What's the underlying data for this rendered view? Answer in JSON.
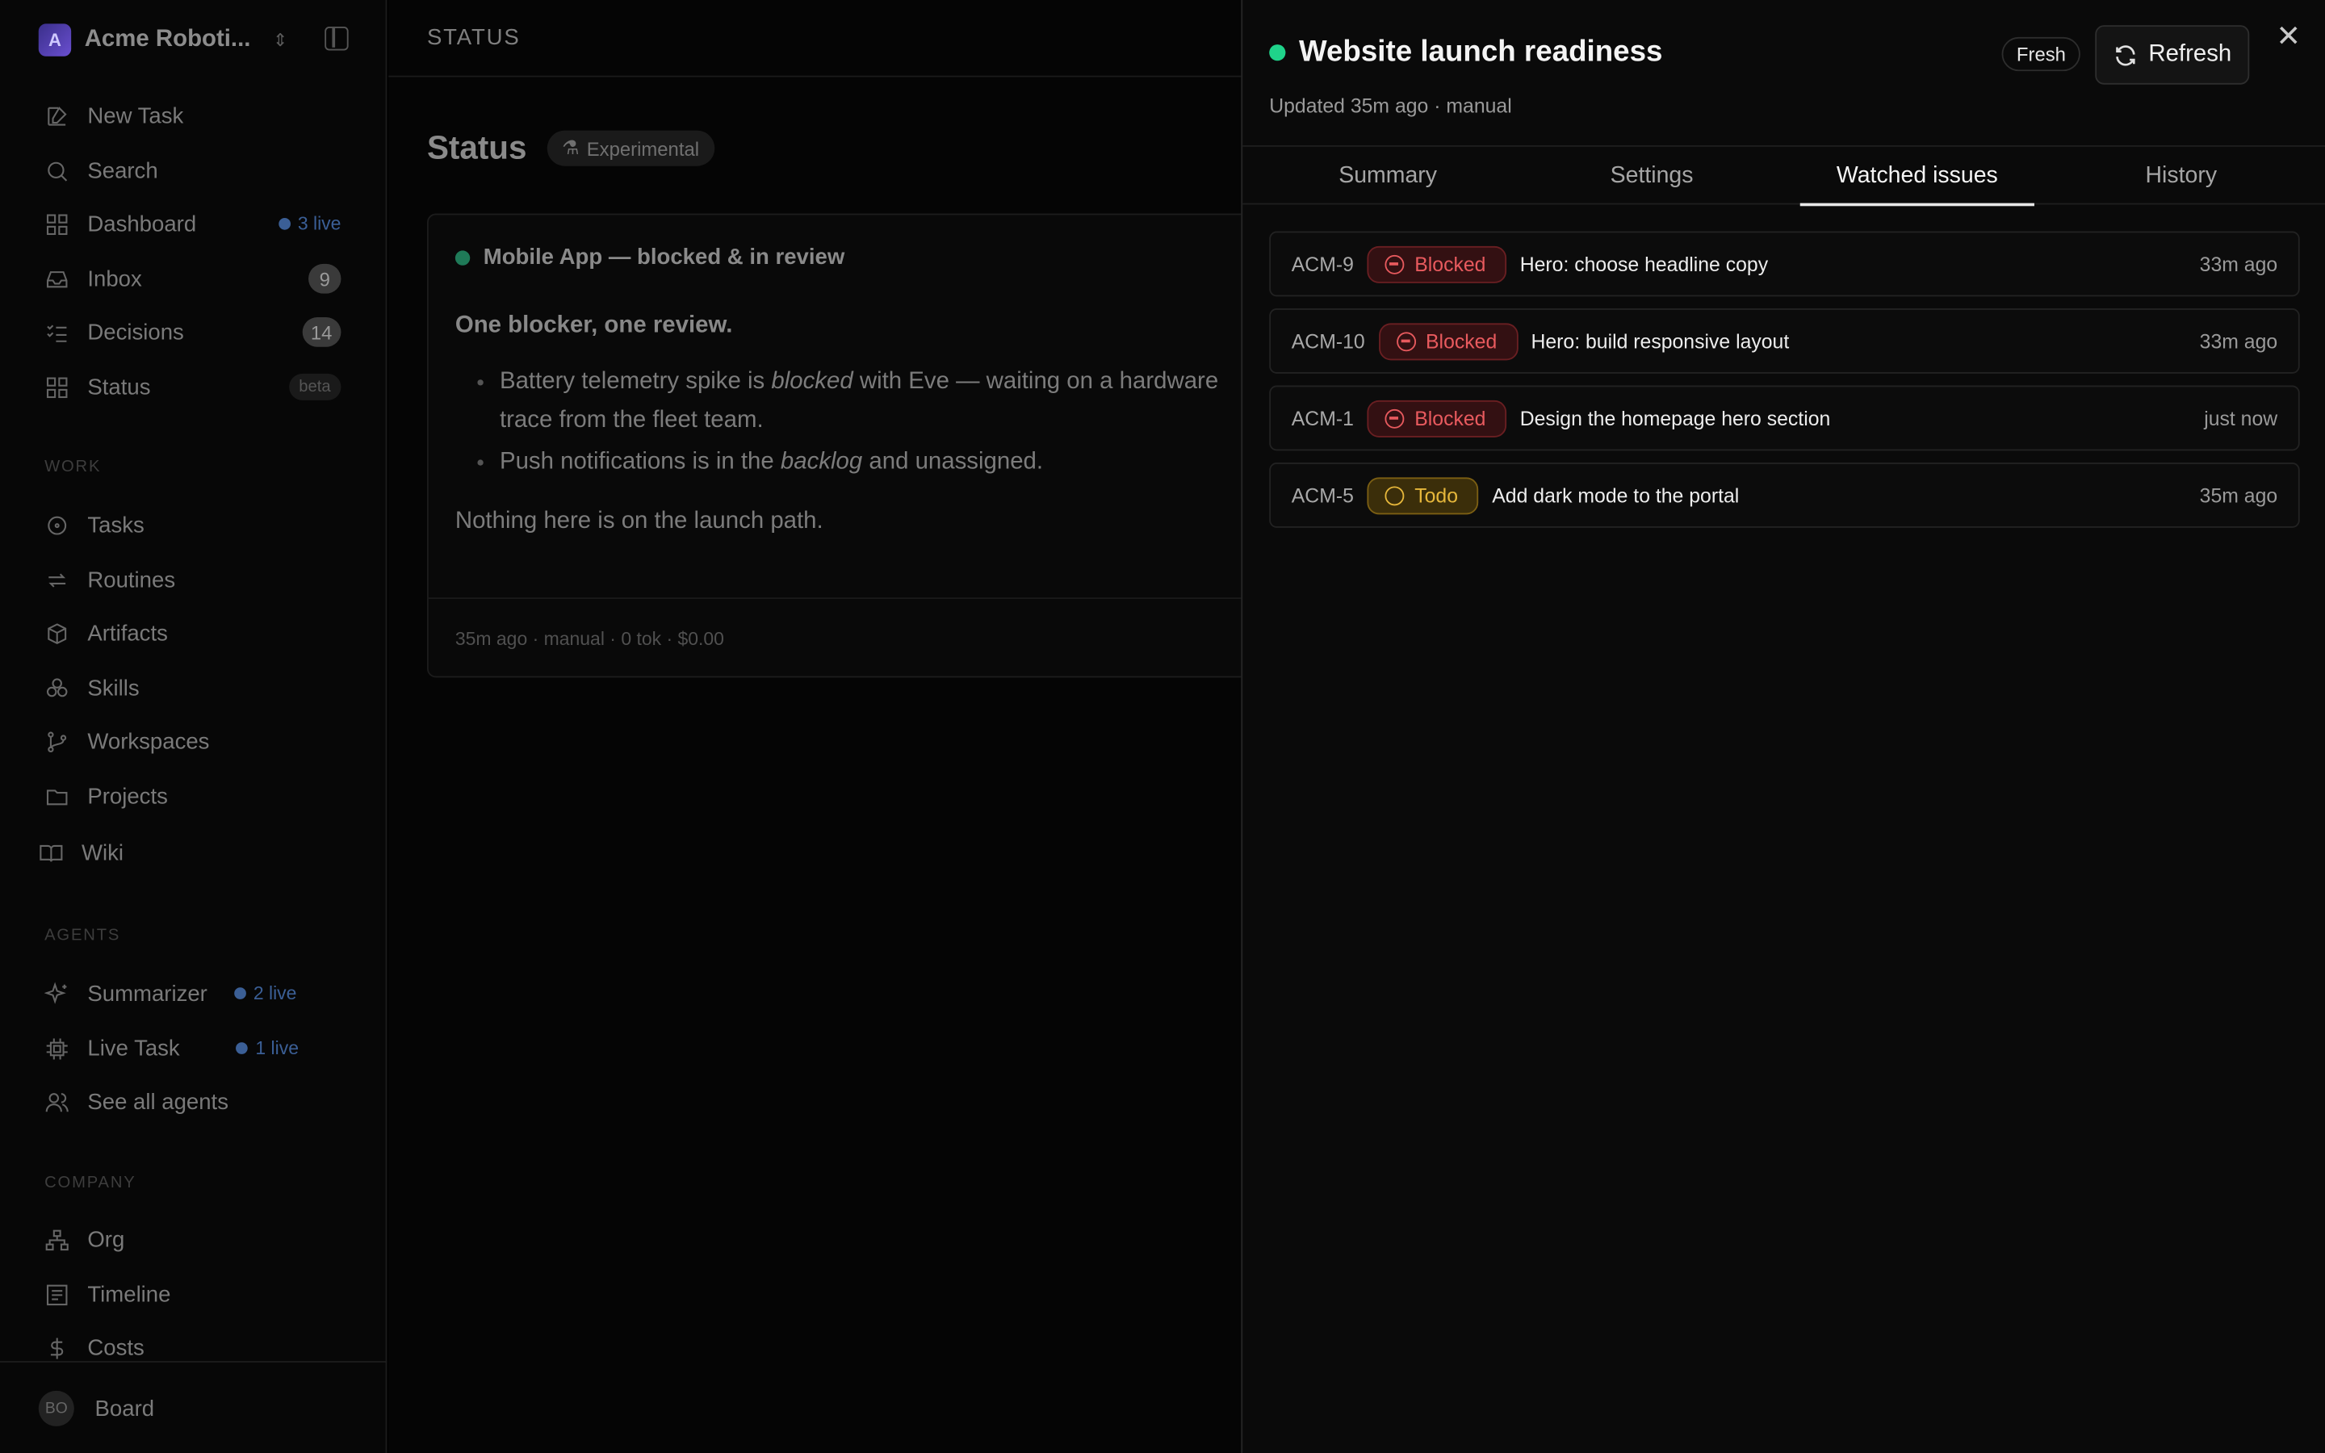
{
  "workspace": {
    "logo_letter": "A",
    "name": "Acme Roboti..."
  },
  "sidebar": {
    "top_items": [
      {
        "label": "New Task"
      },
      {
        "label": "Search"
      },
      {
        "label": "Dashboard",
        "live": "3 live"
      },
      {
        "label": "Inbox",
        "count": "9"
      },
      {
        "label": "Decisions",
        "count": "14"
      },
      {
        "label": "Status",
        "badge": "beta"
      }
    ],
    "work_label": "WORK",
    "work_items": [
      {
        "label": "Tasks"
      },
      {
        "label": "Routines"
      },
      {
        "label": "Artifacts"
      },
      {
        "label": "Skills"
      },
      {
        "label": "Workspaces"
      },
      {
        "label": "Projects"
      },
      {
        "label": "Wiki"
      }
    ],
    "agents_label": "AGENTS",
    "agent_items": [
      {
        "label": "Summarizer",
        "live": "2 live"
      },
      {
        "label": "Live Task",
        "live": "1 live"
      },
      {
        "label": "See all agents"
      }
    ],
    "company_label": "COMPANY",
    "company_items": [
      {
        "label": "Org"
      },
      {
        "label": "Timeline"
      },
      {
        "label": "Costs"
      }
    ],
    "footer": {
      "avatar": "BO",
      "label": "Board"
    }
  },
  "main": {
    "breadcrumb": "STATUS",
    "title": "Status",
    "badge": "Experimental",
    "card": {
      "title": "Mobile App — blocked & in review",
      "heading": "One blocker, one review.",
      "bullet1_a": "Battery telemetry spike is ",
      "bullet1_em": "blocked",
      "bullet1_b": " with Eve — waiting on a hardware",
      "bullet1_c": "trace from the fleet team.",
      "bullet2_a": "Push notifications is in the ",
      "bullet2_em": "backlog",
      "bullet2_b": " and unassigned.",
      "closing": "Nothing here is on the launch path.",
      "footer": "35m ago · manual · 0 tok · $0.00"
    }
  },
  "panel": {
    "title": "Website launch readiness",
    "subtitle": "Updated 35m ago · manual",
    "fresh_label": "Fresh",
    "refresh_label": "Refresh",
    "close_glyph": "✕",
    "tabs": [
      "Summary",
      "Settings",
      "Watched issues",
      "History"
    ],
    "active_tab": "Watched issues",
    "issues": [
      {
        "key": "ACM-9",
        "status": "Blocked",
        "title": "Hero: choose headline copy",
        "time": "33m ago"
      },
      {
        "key": "ACM-10",
        "status": "Blocked",
        "title": "Hero: build responsive layout",
        "time": "33m ago"
      },
      {
        "key": "ACM-1",
        "status": "Blocked",
        "title": "Design the homepage hero section",
        "time": "just now"
      },
      {
        "key": "ACM-5",
        "status": "Todo",
        "title": "Add dark mode to the portal",
        "time": "35m ago"
      }
    ]
  },
  "colors": {
    "fresh_dot": "#1fd38a",
    "blocked": "#e85a5e",
    "todo": "#e6b73b",
    "live": "#3b5f96"
  }
}
